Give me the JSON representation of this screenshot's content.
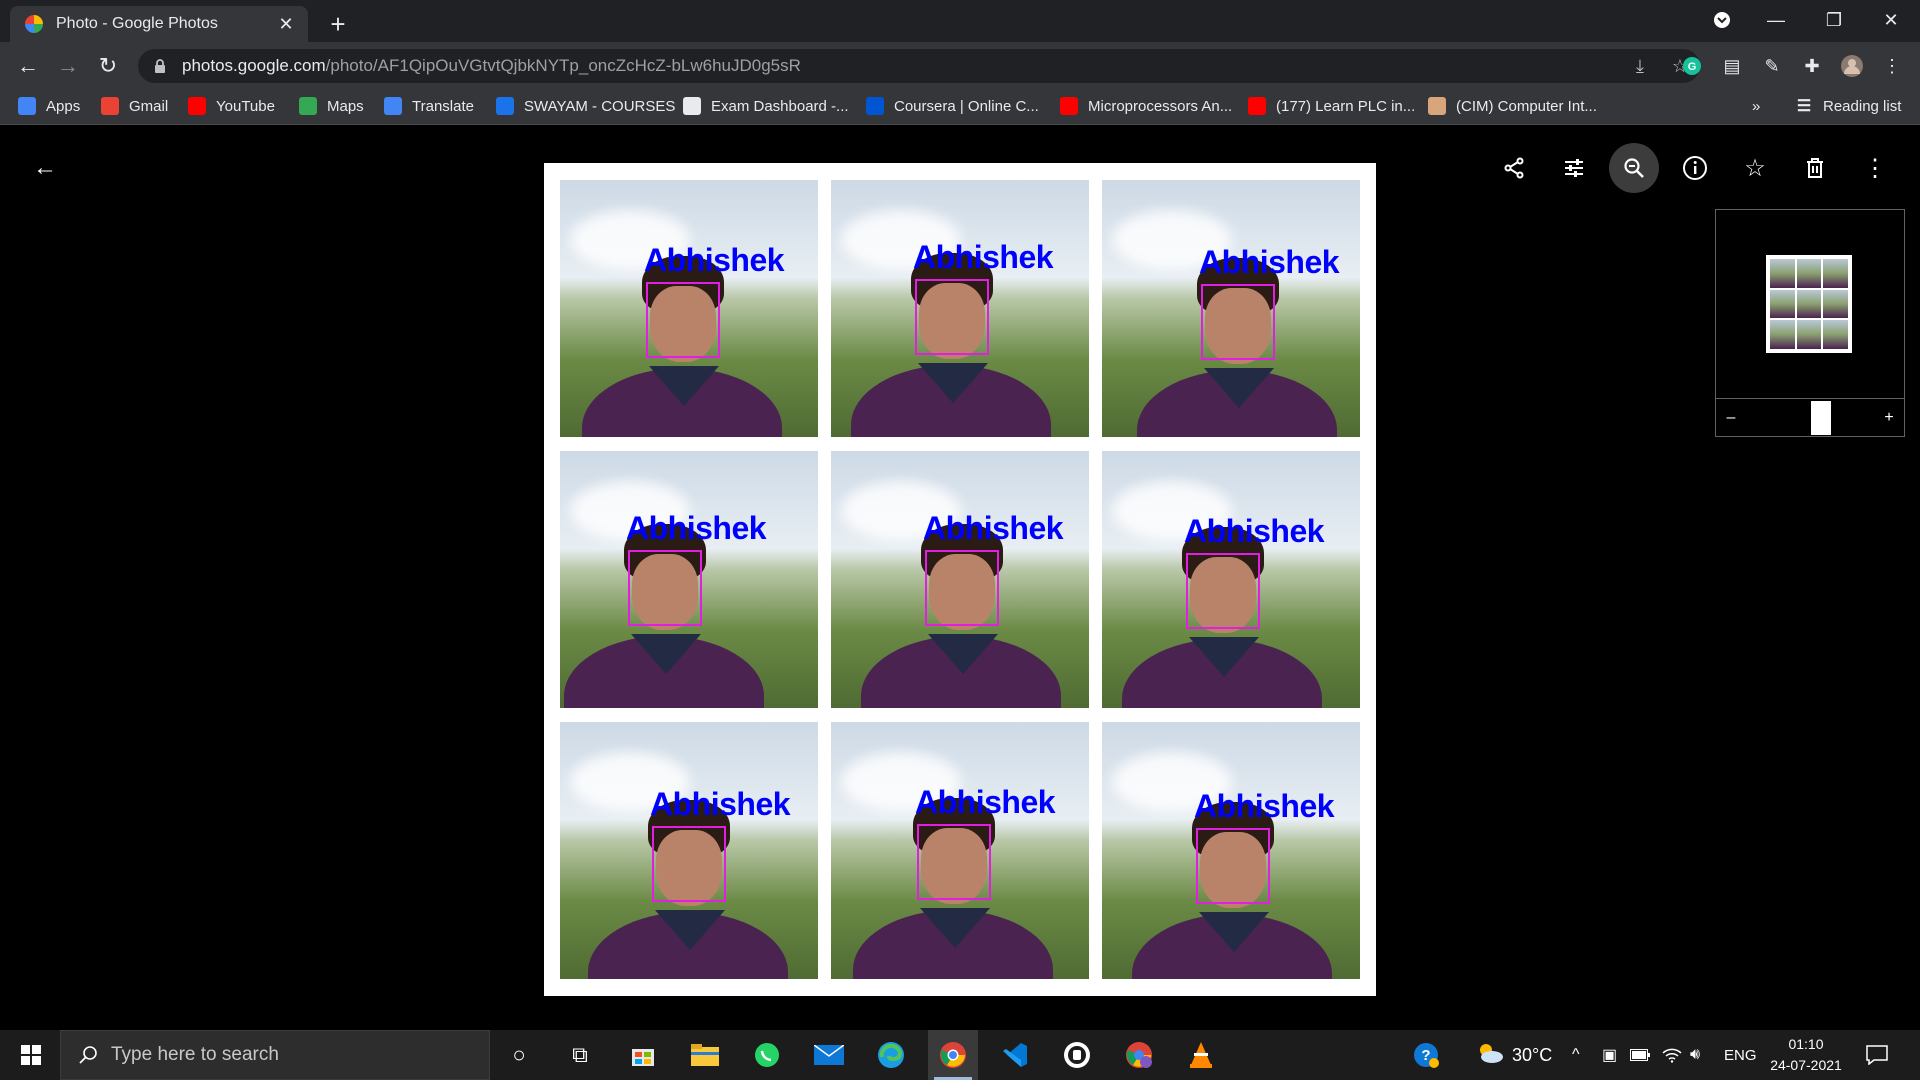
{
  "browser": {
    "tab_title": "Photo - Google Photos",
    "url_host": "photos.google.com",
    "url_path": "/photo/AF1QipOuVGtvtQjbkNYTp_oncZcHcZ-bLw6huJD0g5sR"
  },
  "bookmarks": [
    {
      "label": "Apps",
      "icon": "apps-grid-icon",
      "color": "#4285f4"
    },
    {
      "label": "Gmail",
      "icon": "gmail-icon",
      "color": "#ea4335"
    },
    {
      "label": "YouTube",
      "icon": "youtube-icon",
      "color": "#ff0000"
    },
    {
      "label": "Maps",
      "icon": "maps-pin-icon",
      "color": "#34a853"
    },
    {
      "label": "Translate",
      "icon": "translate-icon",
      "color": "#4285f4"
    },
    {
      "label": "SWAYAM - COURSES",
      "icon": "swayam-icon",
      "color": "#1a73e8"
    },
    {
      "label": "Exam Dashboard -...",
      "icon": "globe-icon",
      "color": "#e8eaed"
    },
    {
      "label": "Coursera | Online C...",
      "icon": "coursera-icon",
      "color": "#0056d2"
    },
    {
      "label": "Microprocessors An...",
      "icon": "youtube-icon",
      "color": "#ff0000"
    },
    {
      "label": "(177) Learn PLC in...",
      "icon": "youtube-icon",
      "color": "#ff0000"
    },
    {
      "label": "(CIM) Computer Int...",
      "icon": "cim-icon",
      "color": "#d9a57a"
    }
  ],
  "bookmarks_overflow": "»",
  "reading_list": "Reading list",
  "photo": {
    "grid": [
      {
        "label": "Abhishek"
      },
      {
        "label": "Abhishek"
      },
      {
        "label": "Abhishek"
      },
      {
        "label": "Abhishek"
      },
      {
        "label": "Abhishek"
      },
      {
        "label": "Abhishek"
      },
      {
        "label": "Abhishek"
      },
      {
        "label": "Abhishek"
      },
      {
        "label": "Abhishek"
      }
    ]
  },
  "navigator": {
    "minus": "–",
    "plus": "+"
  },
  "taskbar": {
    "search_placeholder": "Type here to search",
    "temperature": "30°C",
    "language": "ENG",
    "time": "01:10",
    "date": "24-07-2021"
  },
  "colors": {
    "label_text": "#0000ff",
    "face_box": "#e01fe0",
    "chrome_dark": "#202124",
    "chrome_toolbar": "#35363a"
  }
}
